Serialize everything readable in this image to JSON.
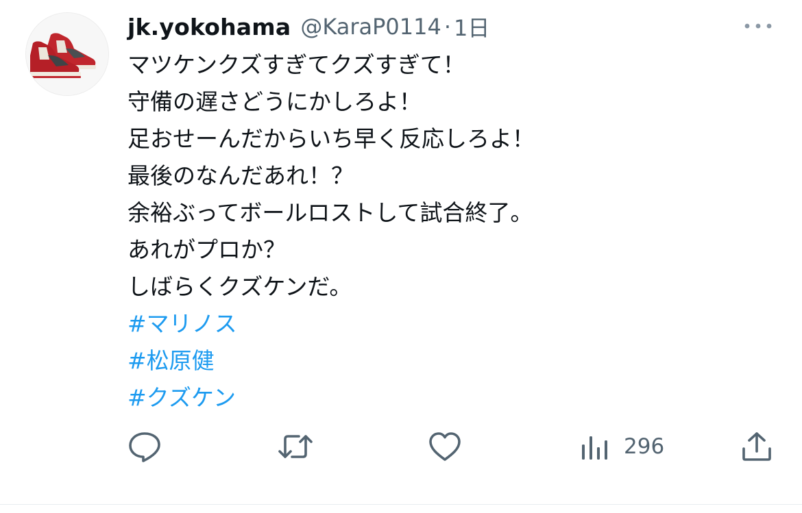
{
  "tweet": {
    "display_name": "jk.yokohama",
    "handle": "@KaraP0114",
    "separator": "·",
    "timestamp": "1日",
    "lines": [
      "マツケンクズすぎてクズすぎて！",
      "守備の遅さどうにかしろよ！",
      "足おせーんだからいち早く反応しろよ！",
      "最後のなんだあれ！？",
      "余裕ぶってボールロストして試合終了。",
      "あれがプロか？",
      "しばらくクズケンだ。"
    ],
    "hashtags": [
      "#マリノス",
      "#松原健",
      "#クズケン"
    ],
    "views_count": "296"
  },
  "icons": {
    "avatar": "sneaker-avatar",
    "more": "more-dots-icon",
    "reply": "reply-icon",
    "retweet": "retweet-icon",
    "like": "heart-icon",
    "views": "views-bar-icon",
    "share": "share-icon"
  },
  "colors": {
    "text": "#0f1419",
    "secondary": "#536471",
    "link": "#1d9bf0"
  }
}
